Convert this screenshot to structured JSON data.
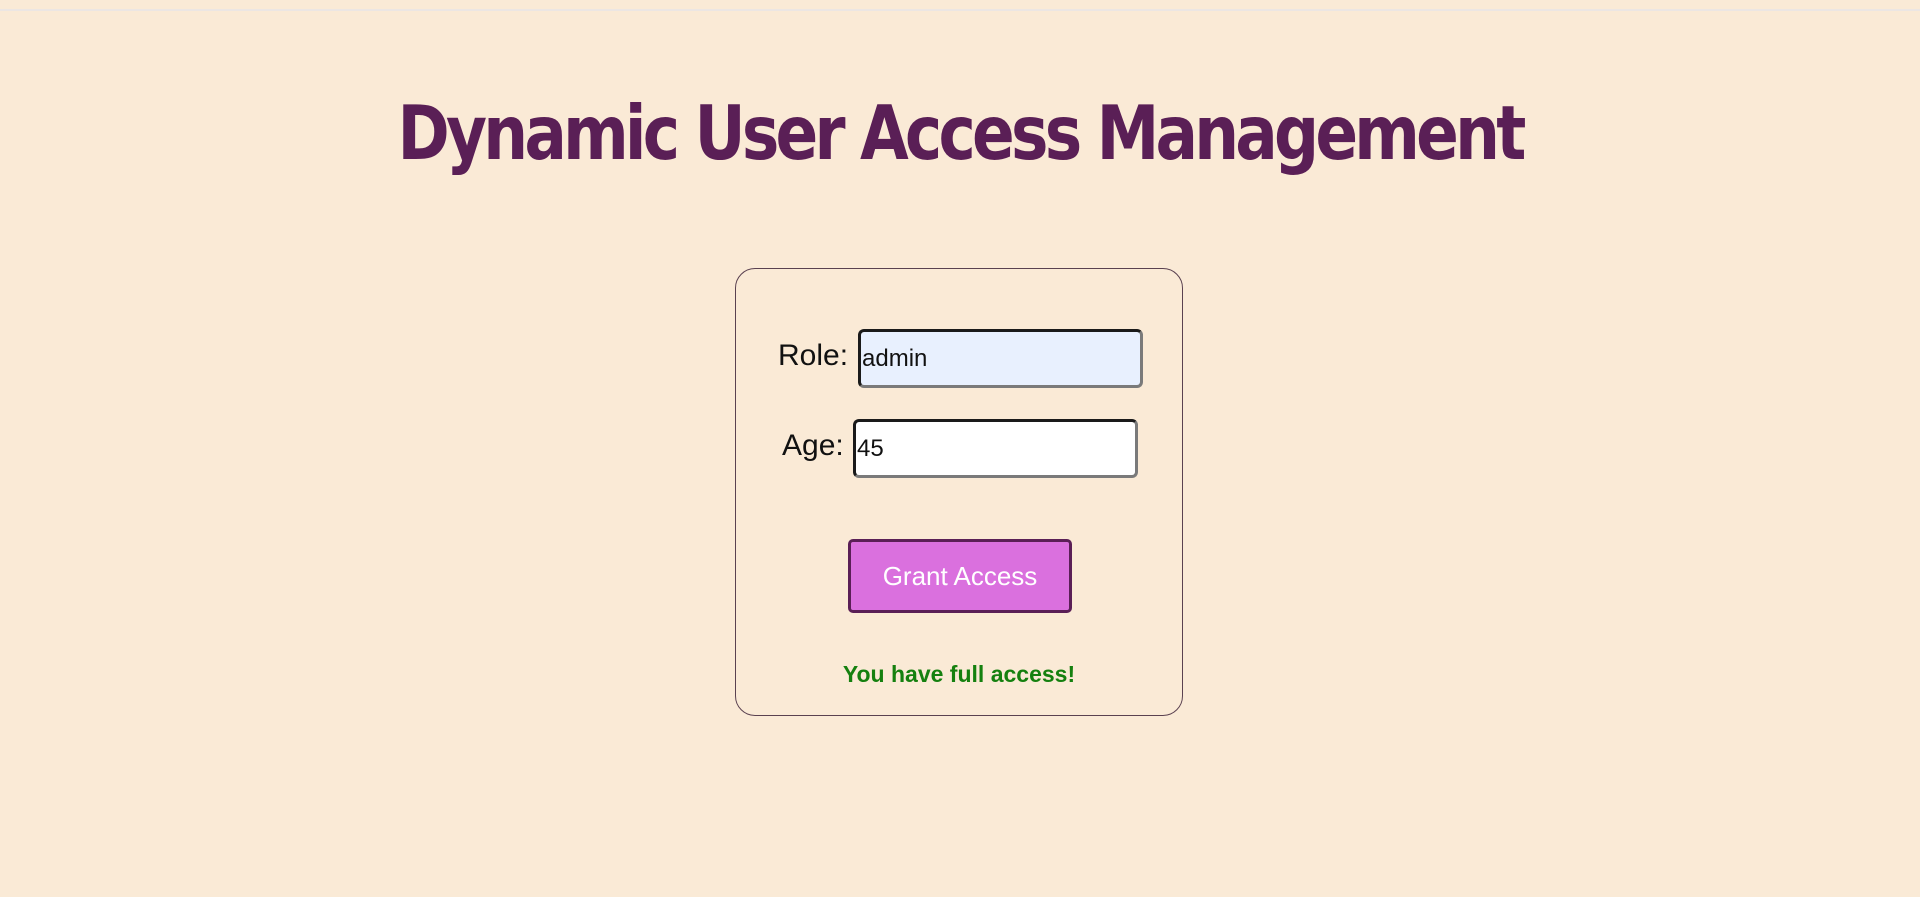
{
  "page": {
    "title": "Dynamic User Access Management"
  },
  "form": {
    "role_label": "Role:",
    "role_value": "admin",
    "age_label": "Age:",
    "age_value": "45",
    "submit_label": "Grant Access",
    "status_message": "You have full access!"
  },
  "colors": {
    "background": "#faead6",
    "title": "#5a1f56",
    "button": "#da70de",
    "button_border": "#5a1f56",
    "success_text": "#15800f",
    "autofill_input": "#e8f0fe"
  }
}
